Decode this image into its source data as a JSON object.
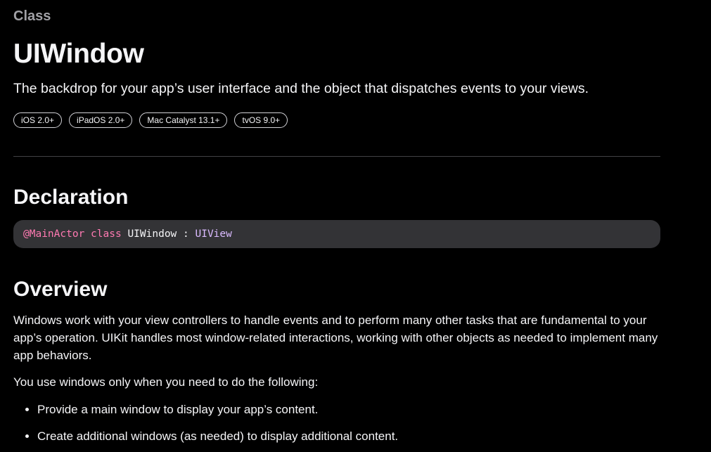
{
  "header": {
    "eyebrow": "Class",
    "title": "UIWindow",
    "abstract": "The backdrop for your app’s user interface and the object that dispatches events to your views."
  },
  "platforms": [
    "iOS 2.0+",
    "iPadOS 2.0+",
    "Mac Catalyst 13.1+",
    "tvOS 9.0+"
  ],
  "declaration": {
    "heading": "Declaration",
    "code": {
      "attribute": "@MainActor",
      "keyword": "class",
      "name": "UIWindow",
      "separator": ":",
      "superclass": "UIView"
    }
  },
  "overview": {
    "heading": "Overview",
    "paragraph_1": "Windows work with your view controllers to handle events and to perform many other tasks that are fundamental to your app’s operation. UIKit handles most window-related interactions, working with other objects as needed to implement many app behaviors.",
    "paragraph_2": "You use windows only when you need to do the following:",
    "bullets": [
      "Provide a main window to display your app’s content.",
      "Create additional windows (as needed) to display additional content."
    ]
  },
  "colors": {
    "background": "#000000",
    "text": "#f5f5f7",
    "secondary_text": "#a1a1a6",
    "code_background": "#333336",
    "code_keyword": "#ff7ab2",
    "code_type": "#dabaff"
  }
}
